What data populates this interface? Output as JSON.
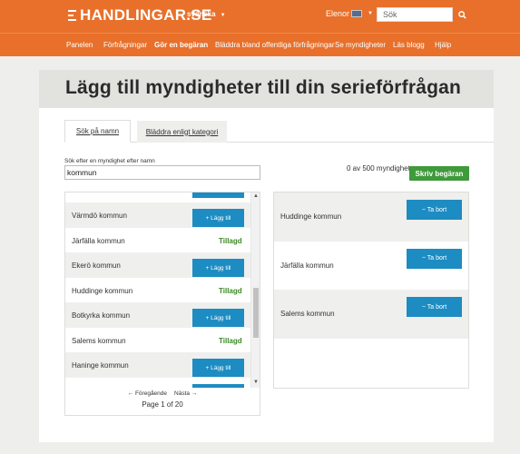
{
  "header": {
    "logo_text": "HANDLINGAR.SE",
    "language": "svenska",
    "user": "Elenor",
    "search_placeholder": "Sök",
    "brand_color": "#e8702a"
  },
  "nav": {
    "items": [
      {
        "label": "Panelen",
        "active": false
      },
      {
        "label": "Förfrågningar",
        "active": false
      },
      {
        "label": "Gör en begäran",
        "active": true
      },
      {
        "label": "Bläddra bland offentliga förfrågningar",
        "active": false
      },
      {
        "label": "Se myndigheter",
        "active": false
      },
      {
        "label": "Läs blogg",
        "active": false
      },
      {
        "label": "Hjälp",
        "active": false
      }
    ]
  },
  "page": {
    "title": "Lägg till myndigheter till din serieförfrågan"
  },
  "tabs": [
    {
      "label": "Sök på namn",
      "active": true
    },
    {
      "label": "Bläddra enligt kategori",
      "active": false
    }
  ],
  "search": {
    "label": "Sök efter en myndighet efter namn",
    "value": "kommun"
  },
  "selection": {
    "count_text": "0 av 500 myndigheter",
    "write_button": "Skriv begäran"
  },
  "results": [
    {
      "name": "Värmdö kommun",
      "status": "add",
      "action_label": "+ Lägg till"
    },
    {
      "name": "Järfälla kommun",
      "status": "added",
      "action_label": "Tillagd"
    },
    {
      "name": "Ekerö kommun",
      "status": "add",
      "action_label": "+ Lägg till"
    },
    {
      "name": "Huddinge kommun",
      "status": "added",
      "action_label": "Tillagd"
    },
    {
      "name": "Botkyrka kommun",
      "status": "add",
      "action_label": "+ Lägg till"
    },
    {
      "name": "Salems kommun",
      "status": "added",
      "action_label": "Tillagd"
    },
    {
      "name": "Haninge kommun",
      "status": "add",
      "action_label": "+ Lägg till"
    }
  ],
  "pagination": {
    "prev": "← Föregående",
    "next": "Nästa →",
    "page_info": "Page 1 of 20"
  },
  "selected": [
    {
      "name": "Huddinge kommun",
      "remove_label": "− Ta bort"
    },
    {
      "name": "Järfälla kommun",
      "remove_label": "− Ta bort"
    },
    {
      "name": "Salems kommun",
      "remove_label": "− Ta bort"
    }
  ],
  "colors": {
    "primary_button": "#1d8cc2",
    "success_button": "#3e9a3a",
    "added_text": "#3b8a24"
  }
}
